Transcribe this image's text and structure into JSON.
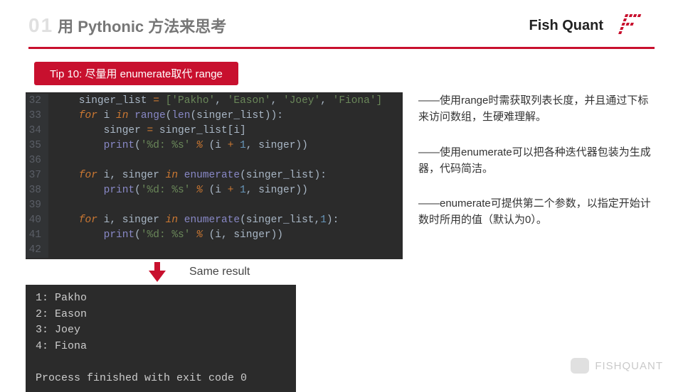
{
  "header": {
    "section_num": "01",
    "title": "用 Pythonic 方法来思考",
    "brand": "Fish Quant"
  },
  "tip": {
    "label": "Tip 10: 尽量用 enumerate取代 range"
  },
  "code": {
    "lines": [
      {
        "n": 32,
        "tokens": [
          [
            "id",
            "    singer_list "
          ],
          [
            "kw",
            "="
          ],
          [
            "id",
            " "
          ],
          [
            "str",
            "["
          ],
          [
            "str",
            "'Pakho'"
          ],
          [
            "id",
            ", "
          ],
          [
            "str",
            "'Eason'"
          ],
          [
            "id",
            ", "
          ],
          [
            "str",
            "'Joey'"
          ],
          [
            "id",
            ", "
          ],
          [
            "str",
            "'Fiona'"
          ],
          [
            "str",
            "]"
          ]
        ]
      },
      {
        "n": 33,
        "tokens": [
          [
            "id",
            "    "
          ],
          [
            "kw",
            "for"
          ],
          [
            "id",
            " i "
          ],
          [
            "kw",
            "in"
          ],
          [
            "id",
            " "
          ],
          [
            "fn",
            "range"
          ],
          [
            "id",
            "("
          ],
          [
            "fn",
            "len"
          ],
          [
            "id",
            "(singer_list)):"
          ]
        ]
      },
      {
        "n": 34,
        "tokens": [
          [
            "id",
            "        singer "
          ],
          [
            "kw",
            "="
          ],
          [
            "id",
            " singer_list[i]"
          ]
        ]
      },
      {
        "n": 35,
        "tokens": [
          [
            "id",
            "        "
          ],
          [
            "fn",
            "print"
          ],
          [
            "id",
            "("
          ],
          [
            "str",
            "'%d: %s'"
          ],
          [
            "id",
            " "
          ],
          [
            "kw",
            "%"
          ],
          [
            "id",
            " (i "
          ],
          [
            "kw",
            "+"
          ],
          [
            "id",
            " "
          ],
          [
            "num2",
            "1"
          ],
          [
            "id",
            ", singer))"
          ]
        ]
      },
      {
        "n": 36,
        "tokens": [
          [
            "id",
            ""
          ]
        ]
      },
      {
        "n": 37,
        "tokens": [
          [
            "id",
            "    "
          ],
          [
            "kw",
            "for"
          ],
          [
            "id",
            " i, singer "
          ],
          [
            "kw",
            "in"
          ],
          [
            "id",
            " "
          ],
          [
            "fn",
            "enumerate"
          ],
          [
            "id",
            "(singer_list):"
          ]
        ]
      },
      {
        "n": 38,
        "tokens": [
          [
            "id",
            "        "
          ],
          [
            "fn",
            "print"
          ],
          [
            "id",
            "("
          ],
          [
            "str",
            "'%d: %s'"
          ],
          [
            "id",
            " "
          ],
          [
            "kw",
            "%"
          ],
          [
            "id",
            " (i "
          ],
          [
            "kw",
            "+"
          ],
          [
            "id",
            " "
          ],
          [
            "num2",
            "1"
          ],
          [
            "id",
            ", singer))"
          ]
        ]
      },
      {
        "n": 39,
        "tokens": [
          [
            "id",
            ""
          ]
        ]
      },
      {
        "n": 40,
        "tokens": [
          [
            "id",
            "    "
          ],
          [
            "kw",
            "for"
          ],
          [
            "id",
            " i, singer "
          ],
          [
            "kw",
            "in"
          ],
          [
            "id",
            " "
          ],
          [
            "fn",
            "enumerate"
          ],
          [
            "id",
            "(singer_list,"
          ],
          [
            "num2",
            "1"
          ],
          [
            "id",
            "):"
          ]
        ]
      },
      {
        "n": 41,
        "tokens": [
          [
            "id",
            "        "
          ],
          [
            "fn",
            "print"
          ],
          [
            "id",
            "("
          ],
          [
            "str",
            "'%d: %s'"
          ],
          [
            "id",
            " "
          ],
          [
            "kw",
            "%"
          ],
          [
            "id",
            " (i, singer))"
          ]
        ]
      },
      {
        "n": 42,
        "tokens": [
          [
            "id",
            ""
          ]
        ]
      }
    ]
  },
  "arrow_label": "Same result",
  "output": "1: Pakho\n2: Eason\n3: Joey\n4: Fiona\n\nProcess finished with exit code 0",
  "notes": {
    "p1": "——使用range时需获取列表长度，并且通过下标来访问数组，生硬难理解。",
    "p2": "——使用enumerate可以把各种迭代器包装为生成器，代码简洁。",
    "p3": "——enumerate可提供第二个参数，以指定开始计数时所用的值（默认为0）。"
  },
  "watermark": {
    "text": "FISHQUANT"
  }
}
